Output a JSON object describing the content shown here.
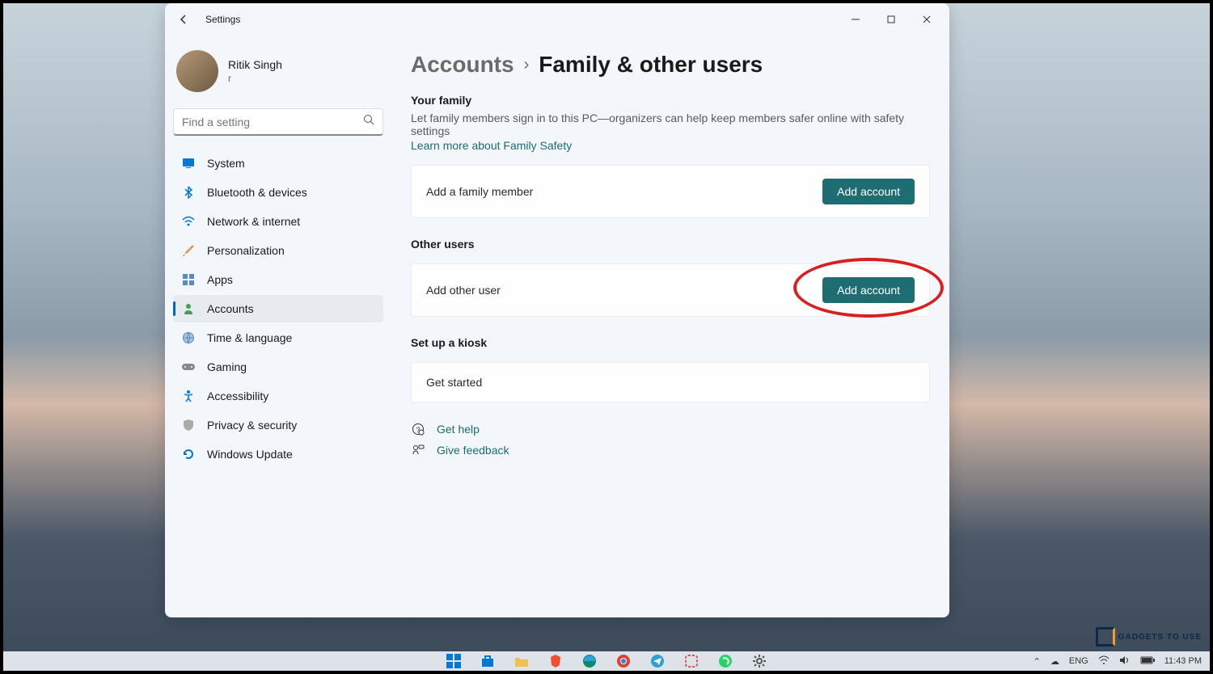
{
  "window": {
    "title": "Settings"
  },
  "user": {
    "name": "Ritik Singh",
    "email": "r"
  },
  "search": {
    "placeholder": "Find a setting"
  },
  "nav": {
    "system": "System",
    "bluetooth": "Bluetooth & devices",
    "network": "Network & internet",
    "personalization": "Personalization",
    "apps": "Apps",
    "accounts": "Accounts",
    "time": "Time & language",
    "gaming": "Gaming",
    "accessibility": "Accessibility",
    "privacy": "Privacy & security",
    "update": "Windows Update"
  },
  "breadcrumb": {
    "root": "Accounts",
    "current": "Family & other users"
  },
  "family": {
    "heading": "Your family",
    "desc": "Let family members sign in to this PC—organizers can help keep members safer online with safety settings",
    "learn_more": "Learn more about Family Safety",
    "card_label": "Add a family member",
    "add_btn": "Add account"
  },
  "other": {
    "heading": "Other users",
    "card_label": "Add other user",
    "add_btn": "Add account"
  },
  "kiosk": {
    "heading": "Set up a kiosk",
    "card_label": "Get started"
  },
  "help": {
    "get_help": "Get help",
    "feedback": "Give feedback"
  },
  "systray": {
    "lang": "ENG",
    "time": "11:43 PM"
  },
  "watermark": "GADGETS TO USE"
}
